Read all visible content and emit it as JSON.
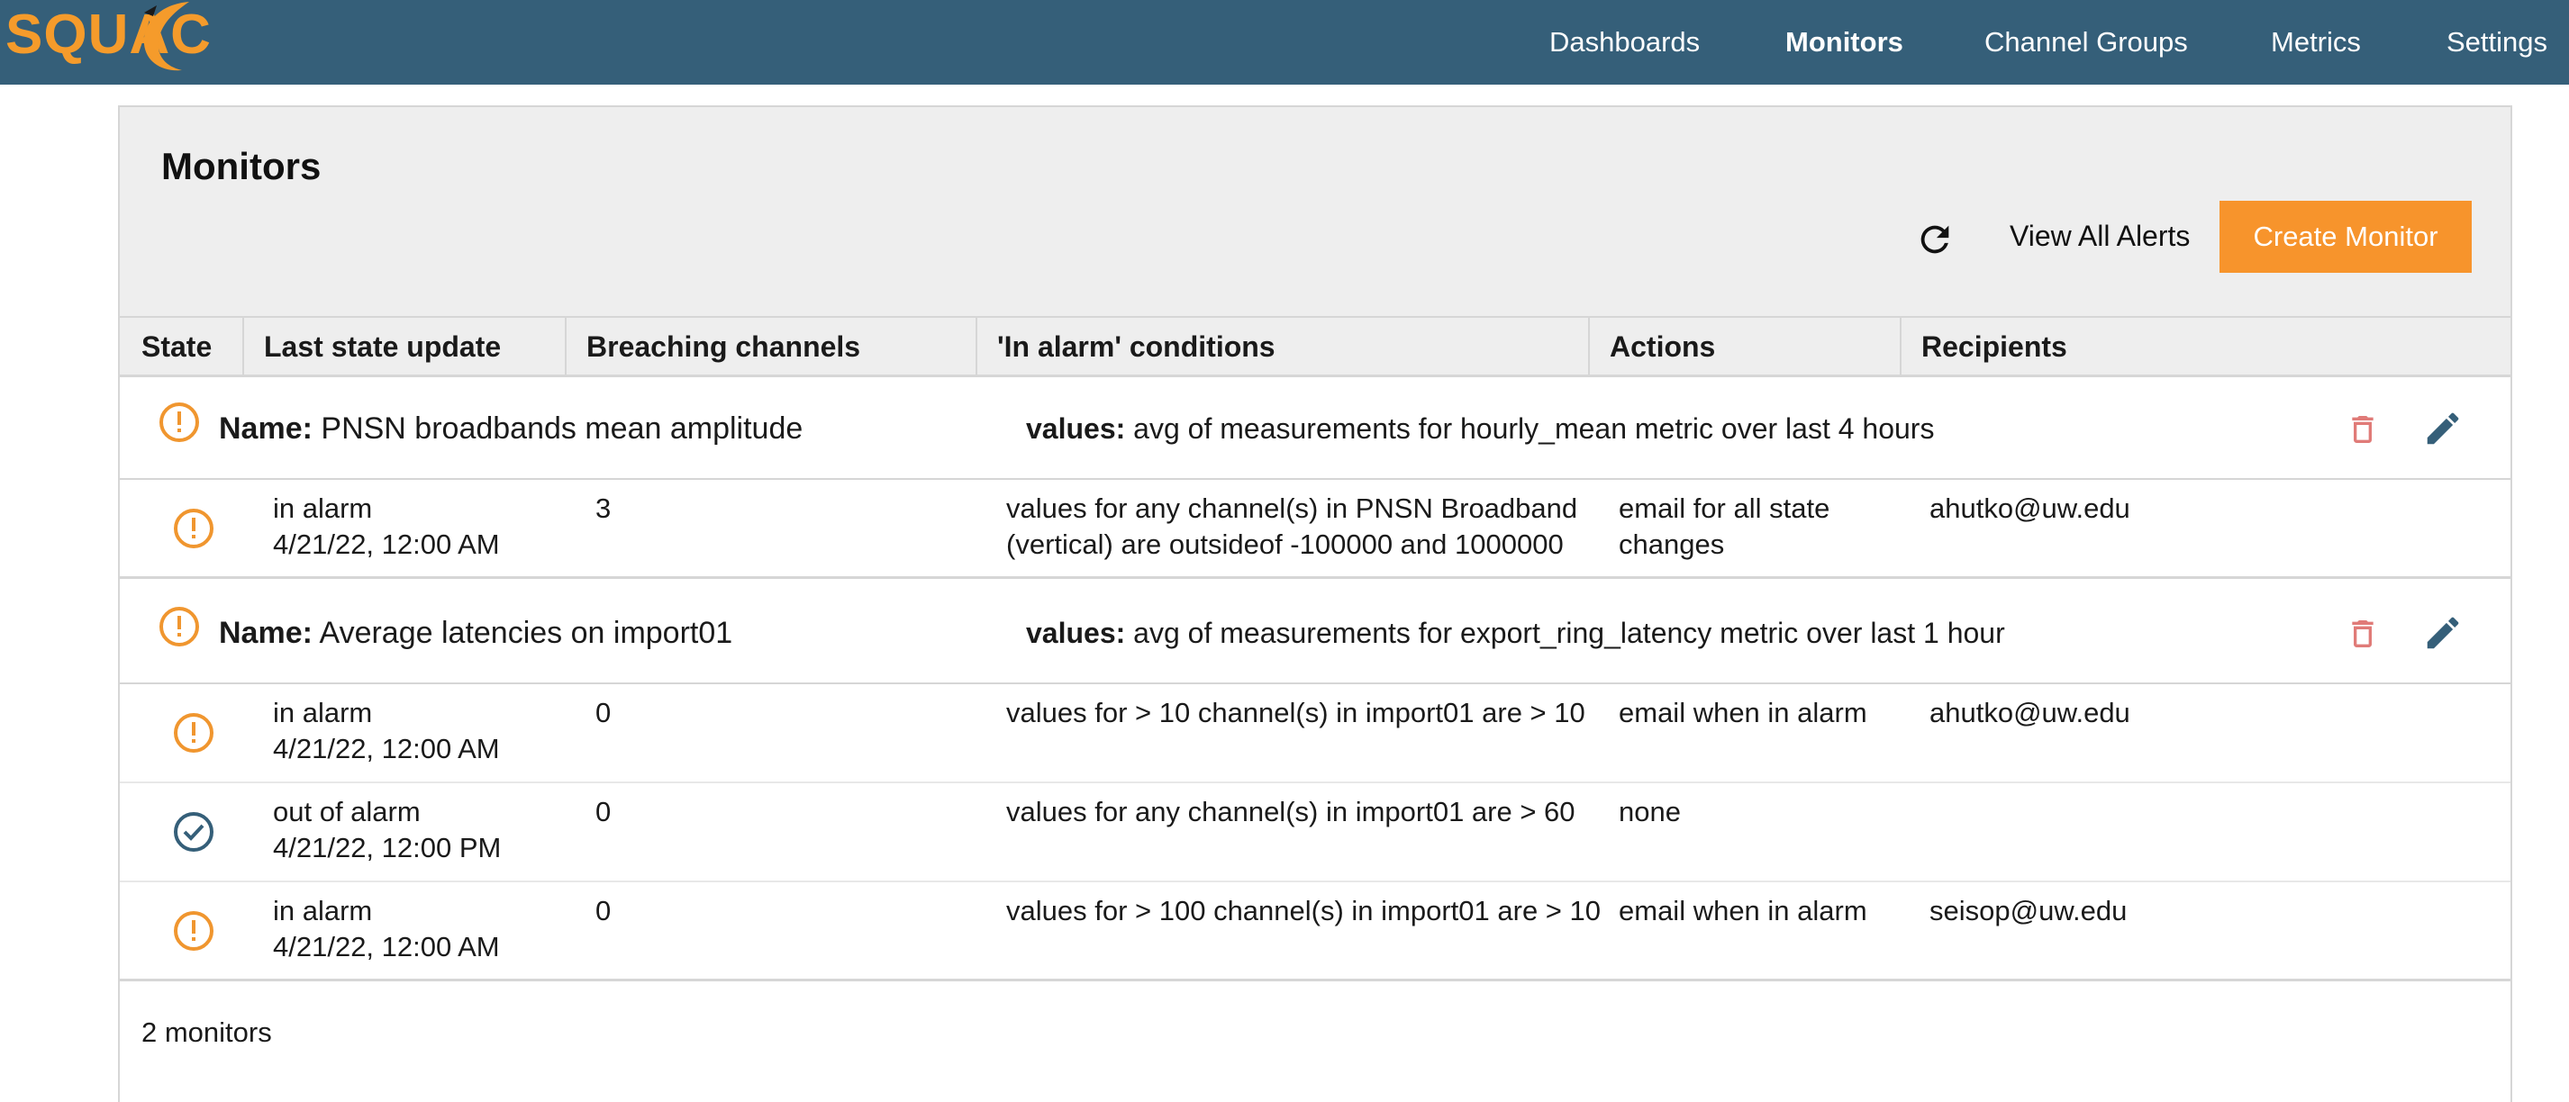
{
  "app": {
    "logo_text": "SQUAC"
  },
  "nav": {
    "items": [
      {
        "label": "Dashboards",
        "active": false
      },
      {
        "label": "Monitors",
        "active": true
      },
      {
        "label": "Channel Groups",
        "active": false
      },
      {
        "label": "Metrics",
        "active": false
      },
      {
        "label": "Settings",
        "active": false
      }
    ]
  },
  "page": {
    "title": "Monitors",
    "view_all_alerts": "View All Alerts",
    "create_monitor": "Create Monitor"
  },
  "columns": [
    "State",
    "Last state update",
    "Breaching channels",
    "'In alarm' conditions",
    "Actions",
    "Recipients"
  ],
  "monitors": [
    {
      "name_label": "Name:",
      "name": "PNSN broadbands mean amplitude",
      "values_label": "values:",
      "values": "avg of measurements for hourly_mean metric over last 4 hours",
      "state": "alarm",
      "alerts": [
        {
          "state_icon": "alarm",
          "state": "in alarm",
          "time": "4/21/22, 12:00 AM",
          "breaching": "3",
          "condition": "values for any channel(s) in PNSN Broadband (vertical) are outsideof -100000 and 1000000",
          "action": "email for all state changes",
          "recipients": "ahutko@uw.edu"
        }
      ]
    },
    {
      "name_label": "Name:",
      "name": "Average latencies on import01",
      "values_label": "values:",
      "values": "avg of measurements for export_ring_latency metric over last 1 hour",
      "state": "alarm",
      "alerts": [
        {
          "state_icon": "alarm",
          "state": "in alarm",
          "time": "4/21/22, 12:00 AM",
          "breaching": "0",
          "condition": "values for > 10 channel(s) in import01 are > 10",
          "action": "email when in alarm",
          "recipients": "ahutko@uw.edu"
        },
        {
          "state_icon": "ok",
          "state": "out of alarm",
          "time": "4/21/22, 12:00 PM",
          "breaching": "0",
          "condition": "values for any channel(s) in import01 are > 60",
          "action": "none",
          "recipients": ""
        },
        {
          "state_icon": "alarm",
          "state": "in alarm",
          "time": "4/21/22, 12:00 AM",
          "breaching": "0",
          "condition": "values for > 100 channel(s) in import01 are > 10",
          "action": "email when in alarm",
          "recipients": "seisop@uw.edu"
        }
      ]
    }
  ],
  "footer": {
    "count": "2 monitors"
  },
  "colors": {
    "navbar": "#355f79",
    "accent_orange": "#f7942c",
    "alarm_icon": "#f0962f",
    "ok_icon": "#355f79",
    "delete_icon": "#e07b78",
    "edit_icon": "#355f79"
  },
  "icons": {
    "refresh": "refresh-icon",
    "alarm": "alert-circle-icon",
    "ok": "check-circle-icon",
    "delete": "trash-icon",
    "edit": "pencil-icon"
  }
}
